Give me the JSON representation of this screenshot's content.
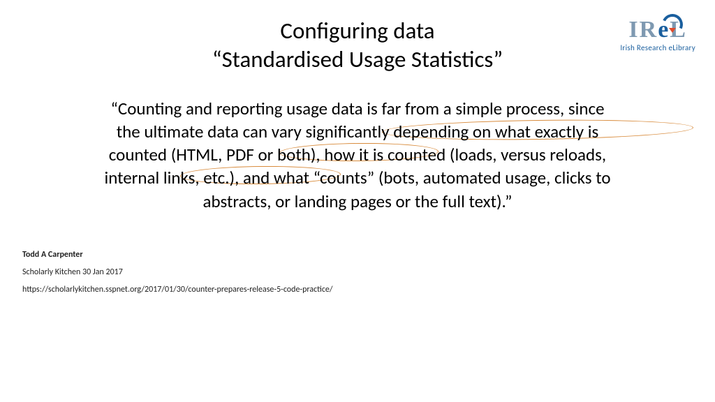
{
  "logo": {
    "text_prefix": "IR",
    "text_e": "e",
    "text_suffix": "L",
    "sub": "Irish Research eLibrary"
  },
  "title": {
    "line1": "Configuring data",
    "line2": "“Standardised Usage Statistics”"
  },
  "quote": {
    "l1": "“Counting and reporting usage data is far from a simple process, since",
    "l2": "the ultimate data can vary significantly depending on what exactly is",
    "l3": "counted (HTML, PDF or both), how it is counted (loads, versus reloads,",
    "l4": "internal links, etc.), and what “counts” (bots, automated usage, clicks to",
    "l5": "abstracts, or landing pages or the full text).”"
  },
  "citation": {
    "author": "Todd A Carpenter",
    "source": "Scholarly Kitchen 30 Jan 2017",
    "url": "https://scholarlykitchen.sspnet.org/2017/01/30/counter-prepares-release-5-code-practice/"
  }
}
